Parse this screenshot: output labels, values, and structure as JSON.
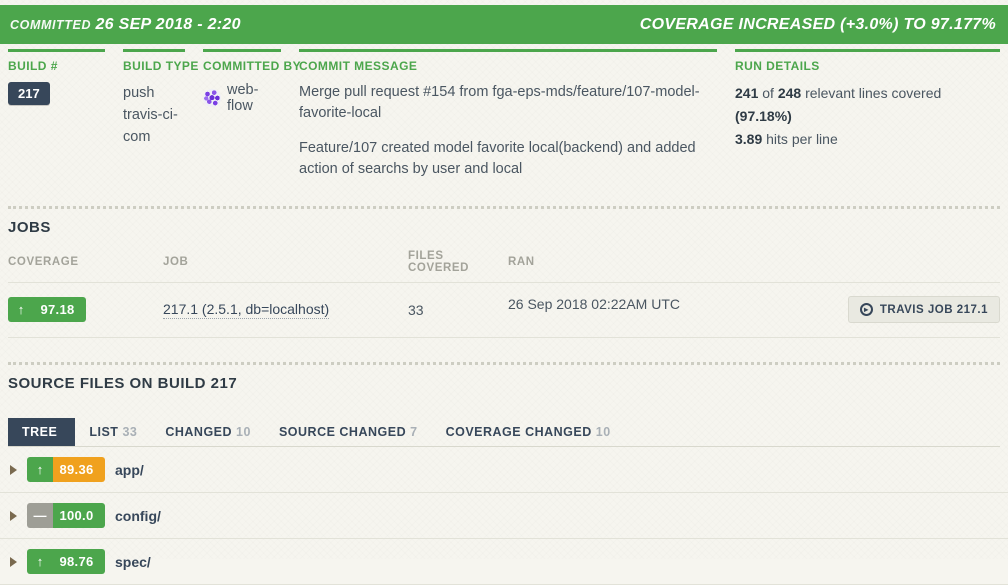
{
  "banner": {
    "committed_label": "COMMITTED",
    "committed_date": "26 SEP 2018 - 2:20",
    "coverage_status": "COVERAGE INCREASED (+3.0%) TO 97.177%",
    "color": "#4ca64c"
  },
  "summary": {
    "build": {
      "title": "BUILD #",
      "number": "217"
    },
    "build_type": {
      "title": "BUILD TYPE",
      "line1": "push",
      "line2": "travis-ci-",
      "line3": "com"
    },
    "committed_by": {
      "title": "COMMITTED BY",
      "user": "web-flow",
      "avatar_icon": "identicon-avatar"
    },
    "commit_message": {
      "title": "COMMIT MESSAGE",
      "paragraph1": "Merge pull request #154 from fga-eps-mds/feature/107-model-favorite-local",
      "paragraph2": "Feature/107 created model favorite local(backend) and added action of searchs by user and local"
    },
    "run_details": {
      "title": "RUN DETAILS",
      "covered_count": "241",
      "of_word": "of",
      "total_count": "248",
      "relevant_text": "relevant lines covered",
      "percent": "(97.18%)",
      "hits_value": "3.89",
      "hits_text": "hits per line"
    }
  },
  "jobs": {
    "section_title": "JOBS",
    "columns": {
      "coverage": "COVERAGE",
      "job": "JOB",
      "files_covered": "FILES COVERED",
      "ran": "RAN"
    },
    "rows": [
      {
        "coverage_badge": {
          "value": "97.18",
          "icon": "arrow-up-icon",
          "icon_glyph": "↑",
          "icon_color": "#4ca64c",
          "value_color": "#4ca64c"
        },
        "job_link": "217.1 (2.5.1, db=localhost)",
        "files_covered": "33",
        "ran": "26 Sep 2018 02:22AM UTC",
        "action_button": {
          "label": "TRAVIS JOB 217.1",
          "icon": "external-link-circle-icon",
          "icon_glyph": "▸"
        }
      }
    ]
  },
  "source_files": {
    "section_title": "SOURCE FILES ON BUILD 217",
    "tabs": [
      {
        "label": "TREE",
        "count": "",
        "active": true
      },
      {
        "label": "LIST",
        "count": "33",
        "active": false
      },
      {
        "label": "CHANGED",
        "count": "10",
        "active": false
      },
      {
        "label": "SOURCE CHANGED",
        "count": "7",
        "active": false
      },
      {
        "label": "COVERAGE CHANGED",
        "count": "10",
        "active": false
      }
    ],
    "tree": [
      {
        "name": "app/",
        "caret_icon": "caret-right-icon",
        "badge": {
          "value": "89.36",
          "icon": "arrow-up-icon",
          "icon_glyph": "↑",
          "icon_color": "#4ca64c",
          "value_color": "#f0a11e"
        }
      },
      {
        "name": "config/",
        "caret_icon": "caret-right-icon",
        "badge": {
          "value": "100.0",
          "icon": "dash-icon",
          "icon_glyph": "—",
          "icon_color": "#9e9e96",
          "value_color": "#4ca64c"
        }
      },
      {
        "name": "spec/",
        "caret_icon": "caret-right-icon",
        "badge": {
          "value": "98.76",
          "icon": "arrow-up-icon",
          "icon_glyph": "↑",
          "icon_color": "#4ca64c",
          "value_color": "#4ca64c"
        }
      }
    ]
  }
}
